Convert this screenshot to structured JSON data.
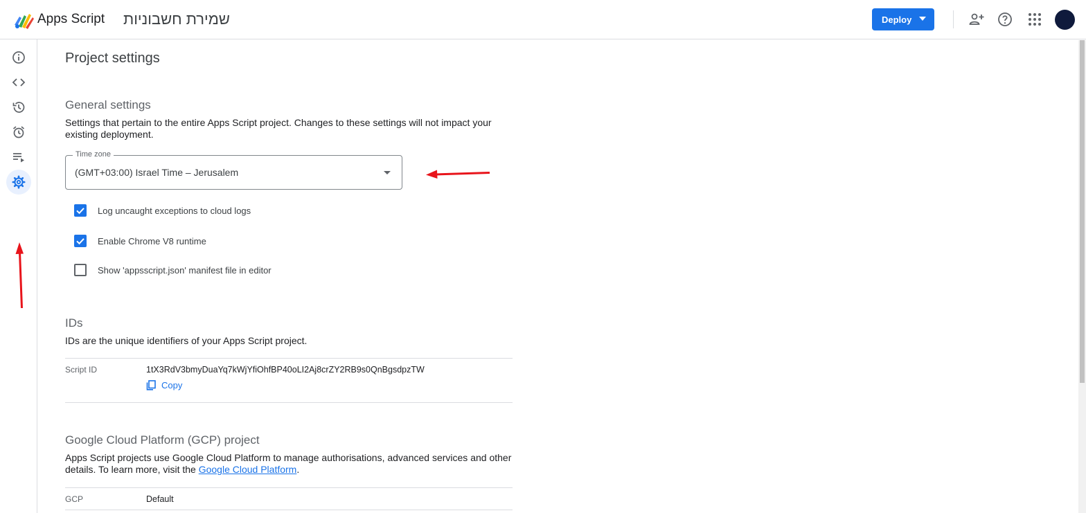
{
  "header": {
    "app_name": "Apps Script",
    "project_name": "שמירת חשבוניות",
    "deploy_label": "Deploy",
    "icons": [
      "add-person-icon",
      "help-icon",
      "apps-grid-icon"
    ]
  },
  "sidebar": {
    "items": [
      {
        "name": "overview",
        "icon": "info-icon"
      },
      {
        "name": "editor",
        "icon": "code-icon"
      },
      {
        "name": "executions",
        "icon": "history-icon"
      },
      {
        "name": "triggers",
        "icon": "alarm-icon"
      },
      {
        "name": "executions-list",
        "icon": "playlist-icon"
      },
      {
        "name": "project-settings",
        "icon": "gear-icon",
        "active": true
      }
    ]
  },
  "main": {
    "title": "Project settings",
    "general": {
      "title": "General settings",
      "desc": "Settings that pertain to the entire Apps Script project. Changes to these settings will not impact your existing deployment.",
      "timezone_label": "Time zone",
      "timezone_value": "(GMT+03:00) Israel Time – Jerusalem",
      "checkboxes": [
        {
          "label": "Log uncaught exceptions to cloud logs",
          "checked": true
        },
        {
          "label": "Enable Chrome V8 runtime",
          "checked": true
        },
        {
          "label": "Show 'appsscript.json' manifest file in editor",
          "checked": false
        }
      ]
    },
    "ids": {
      "title": "IDs",
      "desc": "IDs are the unique identifiers of your Apps Script project.",
      "script_id_label": "Script ID",
      "script_id_value": "1tX3RdV3bmyDuaYq7kWjYfiOhfBP40oLI2Aj8crZY2RB9s0QnBgsdpzTW",
      "copy_label": "Copy"
    },
    "gcp": {
      "title": "Google Cloud Platform (GCP) project",
      "desc_before": "Apps Script projects use Google Cloud Platform to manage authorisations, advanced services and other details. To learn more, visit the ",
      "desc_link": "Google Cloud Platform",
      "desc_after": ".",
      "gcp_label": "GCP",
      "gcp_value": "Default"
    }
  },
  "colors": {
    "accent": "#1a73e8",
    "annotation_arrow": "#e8141b",
    "avatar": "#0f1a3c"
  }
}
